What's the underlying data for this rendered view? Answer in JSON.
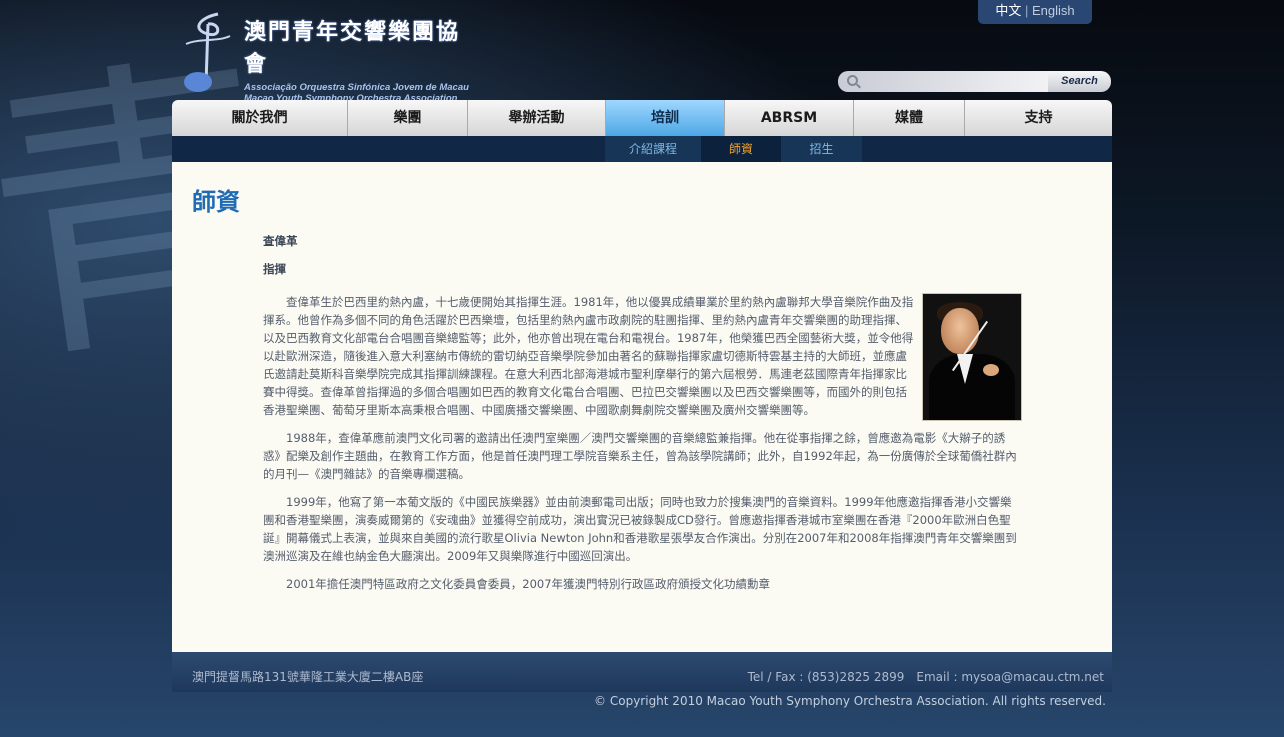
{
  "logo": {
    "name_zh": "澳門青年交響樂團協會",
    "name_pt": "Associação Orquestra Sinfónica Jovem de Macau",
    "name_en": "Macao Youth Symphony Orchestra Association"
  },
  "lang": {
    "zh": "中文",
    "separator": "|",
    "en": "English"
  },
  "search": {
    "value": "",
    "button_label": "Search"
  },
  "nav": {
    "items": [
      {
        "label": "關於我們"
      },
      {
        "label": "樂團"
      },
      {
        "label": "舉辦活動"
      },
      {
        "label": "培訓"
      },
      {
        "label": "ABRSM"
      },
      {
        "label": "媒體"
      },
      {
        "label": "支持"
      }
    ],
    "active": "培訓"
  },
  "subnav": {
    "items": [
      {
        "label": "介紹課程"
      },
      {
        "label": "師資"
      },
      {
        "label": "招生"
      }
    ],
    "current": "師資"
  },
  "page": {
    "title": "師資",
    "name": "查偉革",
    "role": "指揮",
    "paragraphs": [
      "查偉革生於巴西里約熱內盧，十七歲便開始其指揮生涯。1981年，他以優異成績畢業於里約熱內盧聯邦大學音樂院作曲及指揮系。他曾作為多個不同的角色活躍於巴西樂壇，包括里約熱內盧市政劇院的駐團指揮、里約熱內盧青年交響樂團的助理指揮、以及巴西教育文化部電台合唱團音樂總監等；此外，他亦曾出現在電台和電視台。1987年，他榮獲巴西全國藝術大獎，並令他得以赴歐洲深造，隨後進入意大利塞納市傳統的雷切納亞音樂學院參加由著名的蘇聯指揮家盧切德斯特雲基主持的大師班，並應盧氏邀請赴莫斯科音樂學院完成其指揮訓練課程。在意大利西北部海港城市聖利摩舉行的第六屆根勞．馬連老茲國際青年指揮家比賽中得獎。查偉革曾指揮過的多個合唱團如巴西的教育文化電台合唱團、巴拉巴交響樂團以及巴西交響樂團等，而國外的則包括香港聖樂團、葡萄牙里斯本高秉根合唱團、中國廣播交響樂團、中國歌劇舞劇院交響樂團及廣州交響樂團等。",
      "1988年，查偉革應前澳門文化司署的邀請出任澳門室樂團／澳門交響樂團的音樂總監兼指揮。他在從事指揮之餘，曾應邀為電影《大辮子的誘惑》配樂及創作主題曲，在教育工作方面，他是首任澳門理工學院音樂系主任，曾為該學院講師；此外，自1992年起，為一份廣傳於全球葡僑社群內的月刊—《澳門雜誌》的音樂專欄選稿。",
      "1999年，他寫了第一本葡文版的《中國民族樂器》並由前澳郵電司出版；同時也致力於搜集澳門的音樂資料。1999年他應邀指揮香港小交響樂團和香港聖樂團，演奏威爾第的《安魂曲》並獲得空前成功，演出實況已被錄製成CD發行。曾應邀指揮香港城市室樂團在香港『2000年歐洲白色聖誕』開幕儀式上表演，並與來自美國的流行歌星Olivia Newton John和香港歌星張學友合作演出。分別在2007年和2008年指揮澳門青年交響樂團到澳洲巡演及在維也納金色大廳演出。2009年又與樂隊進行中國巡回演出。",
      "2001年擔任澳門特區政府之文化委員會委員，2007年獲澳門特別行政區政府頒授文化功績勳章"
    ]
  },
  "footer": {
    "address": "澳門提督馬路131號華隆工業大廈二樓AB座",
    "contact": "Tel / Fax : (853)2825 2899　Email : mysoa@macau.ctm.net",
    "copyright": "© Copyright 2010 Macao Youth Symphony Orchestra Association. All rights reserved."
  }
}
